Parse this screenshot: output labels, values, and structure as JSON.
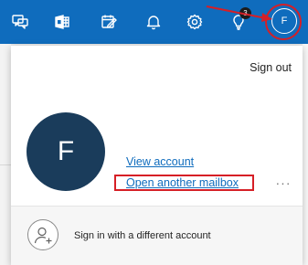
{
  "topbar": {
    "background": "#0f6cbd",
    "buttons": [
      {
        "name": "chat-icon"
      },
      {
        "name": "office-app-icon"
      },
      {
        "name": "calendar-task-icon"
      },
      {
        "name": "bell-icon"
      },
      {
        "name": "gear-icon"
      },
      {
        "name": "lightbulb-icon",
        "badge": "3"
      }
    ],
    "avatar_initial": "F"
  },
  "account_panel": {
    "sign_out": "Sign out",
    "avatar_initial": "F",
    "avatar_color": "#1a3c5b",
    "view_account": "View account",
    "open_another_mailbox": "Open another mailbox",
    "more_icon": "ellipsis-icon",
    "sign_in_different": "Sign in with a different account",
    "add_person_icon": "add-person-icon"
  },
  "annotations": {
    "color": "#d61f26"
  }
}
